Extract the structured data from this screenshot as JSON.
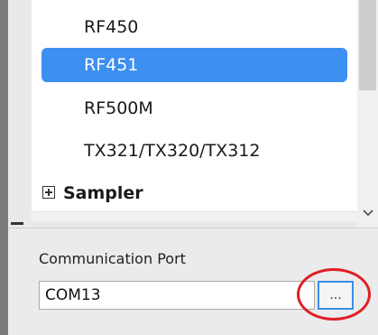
{
  "device_list": {
    "items": [
      {
        "label": "RF450",
        "selected": false
      },
      {
        "label": "RF451",
        "selected": true
      },
      {
        "label": "RF500M",
        "selected": false
      },
      {
        "label": "TX321/TX320/TX312",
        "selected": false
      }
    ]
  },
  "tree": {
    "group_label": "Sampler",
    "expand_symbol": "plus"
  },
  "scrollbar": {
    "down_arrow_icon": "chevron-down-icon"
  },
  "communication": {
    "label": "Communication Port",
    "port_value": "COM13",
    "browse_label": "..."
  },
  "colors": {
    "selection": "#3d8ff0",
    "highlight_circle": "#e01e24",
    "focus_border": "#3c8ee6"
  }
}
